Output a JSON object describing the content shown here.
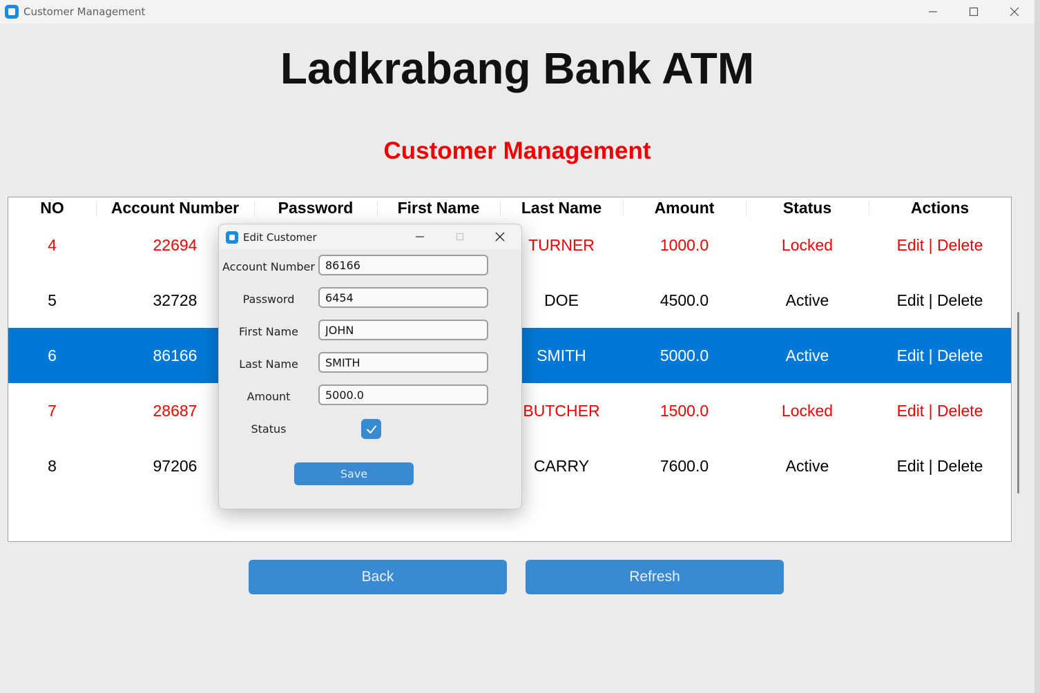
{
  "window": {
    "title": "Customer Management"
  },
  "header": {
    "title": "Ladkrabang Bank ATM",
    "subtitle": "Customer Management"
  },
  "table": {
    "columns": [
      "NO",
      "Account Number",
      "Password",
      "First Name",
      "Last Name",
      "Amount",
      "Status",
      "Actions"
    ],
    "rows": [
      {
        "no": "4",
        "account": "22694",
        "last_name": "TURNER",
        "amount": "1000.0",
        "status": "Locked",
        "actions": "Edit | Delete",
        "state": "locked"
      },
      {
        "no": "5",
        "account": "32728",
        "last_name": "DOE",
        "amount": "4500.0",
        "status": "Active",
        "actions": "Edit | Delete",
        "state": "active"
      },
      {
        "no": "6",
        "account": "86166",
        "last_name": "SMITH",
        "amount": "5000.0",
        "status": "Active",
        "actions": "Edit | Delete",
        "state": "selected"
      },
      {
        "no": "7",
        "account": "28687",
        "last_name": "BUTCHER",
        "amount": "1500.0",
        "status": "Locked",
        "actions": "Edit | Delete",
        "state": "locked"
      },
      {
        "no": "8",
        "account": "97206",
        "last_name": "CARRY",
        "amount": "7600.0",
        "status": "Active",
        "actions": "Edit | Delete",
        "state": "active"
      }
    ]
  },
  "buttons": {
    "back": "Back",
    "refresh": "Refresh"
  },
  "dialog": {
    "title": "Edit Customer",
    "fields": {
      "account_number": {
        "label": "Account Number",
        "value": "86166"
      },
      "password": {
        "label": "Password",
        "value": "6454"
      },
      "first_name": {
        "label": "First Name",
        "value": "JOHN"
      },
      "last_name": {
        "label": "Last Name",
        "value": "SMITH"
      },
      "amount": {
        "label": "Amount",
        "value": "5000.0"
      },
      "status": {
        "label": "Status",
        "checked": true
      }
    },
    "save_label": "Save"
  },
  "colors": {
    "locked_text": "#f00000",
    "selected_row": "#0078d7",
    "button": "#3a8ad1"
  }
}
